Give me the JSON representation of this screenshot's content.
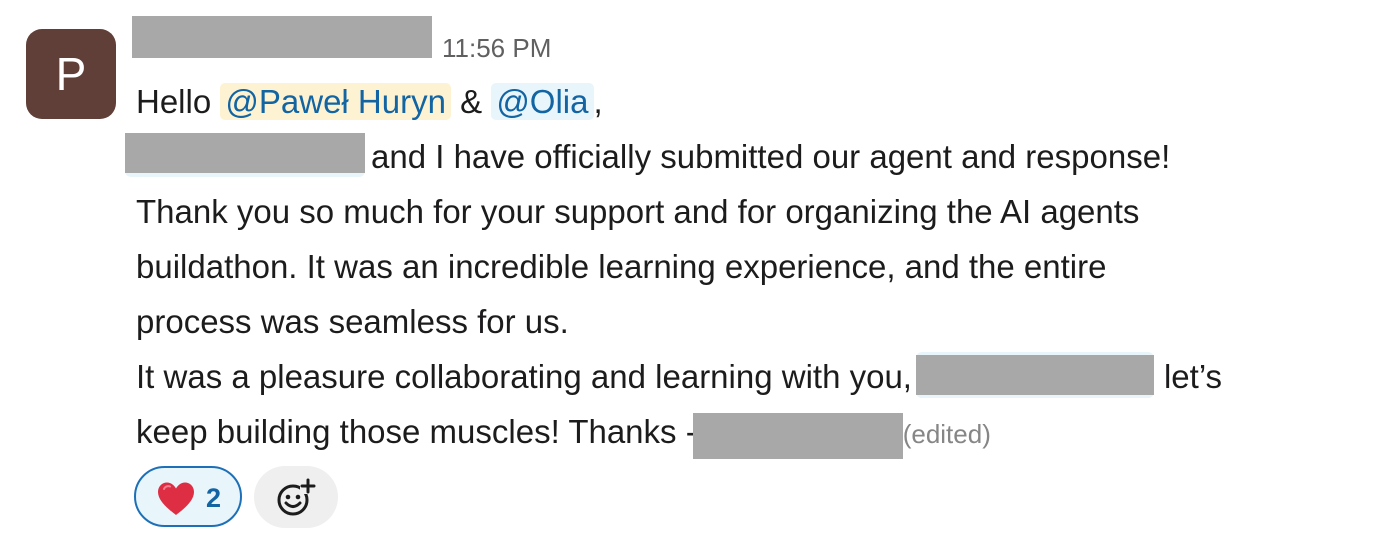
{
  "message": {
    "avatar_initial": "P",
    "timestamp": "11:56 PM",
    "lines": {
      "l1_prefix": "Hello ",
      "mention_1": "@Paweł Huryn",
      "l1_amp": " & ",
      "mention_2": "@Olia",
      "l1_suffix": ",",
      "l2_suffix": "and I have officially submitted our agent and response!",
      "l3": "Thank you so much for your support and for organizing the AI agents",
      "l4": "buildathon. It was an incredible learning experience, and the entire",
      "l5": "process was seamless for us.",
      "l6_prefix": "It was a pleasure collaborating and learning with you,",
      "l6_suffix": "let’s",
      "l7_prefix": "keep building those muscles! Thanks -",
      "edited": "(edited)"
    }
  },
  "reactions": [
    {
      "icon": "red-heart-icon",
      "count": "2",
      "selected": true
    }
  ],
  "add_reaction": {
    "icon": "add-emoji-icon"
  },
  "colors": {
    "avatar_bg": "#5f3f38",
    "mention_text": "#1264a3",
    "mention_bg": "#e8f5fa",
    "self_mention_bg": "#fdf3d2",
    "reaction_border": "#1d70b8",
    "redaction": "#a8a8a8"
  }
}
